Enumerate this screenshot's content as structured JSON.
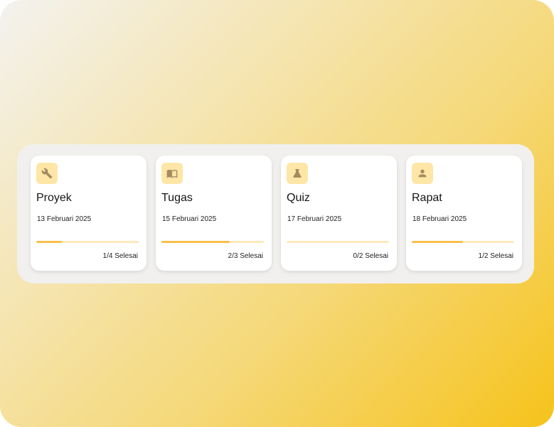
{
  "colors": {
    "icon_bg": "#fde6a6",
    "icon_fg": "#a58b62",
    "progress_track": "#fdebbd",
    "progress_fill": "#f8bf4b"
  },
  "cards": [
    {
      "icon": "wrench-icon",
      "title": "Proyek",
      "date": "13 Februari 2025",
      "status": "1/4 Selesai",
      "progress": 0.25
    },
    {
      "icon": "book-icon",
      "title": "Tugas",
      "date": "15 Februari 2025",
      "status": "2/3 Selesai",
      "progress": 0.6667
    },
    {
      "icon": "flask-icon",
      "title": "Quiz",
      "date": "17 Februari 2025",
      "status": "0/2 Selesai",
      "progress": 0
    },
    {
      "icon": "person-icon",
      "title": "Rapat",
      "date": "18 Februari 2025",
      "status": "1/2 Selesai",
      "progress": 0.5
    }
  ]
}
